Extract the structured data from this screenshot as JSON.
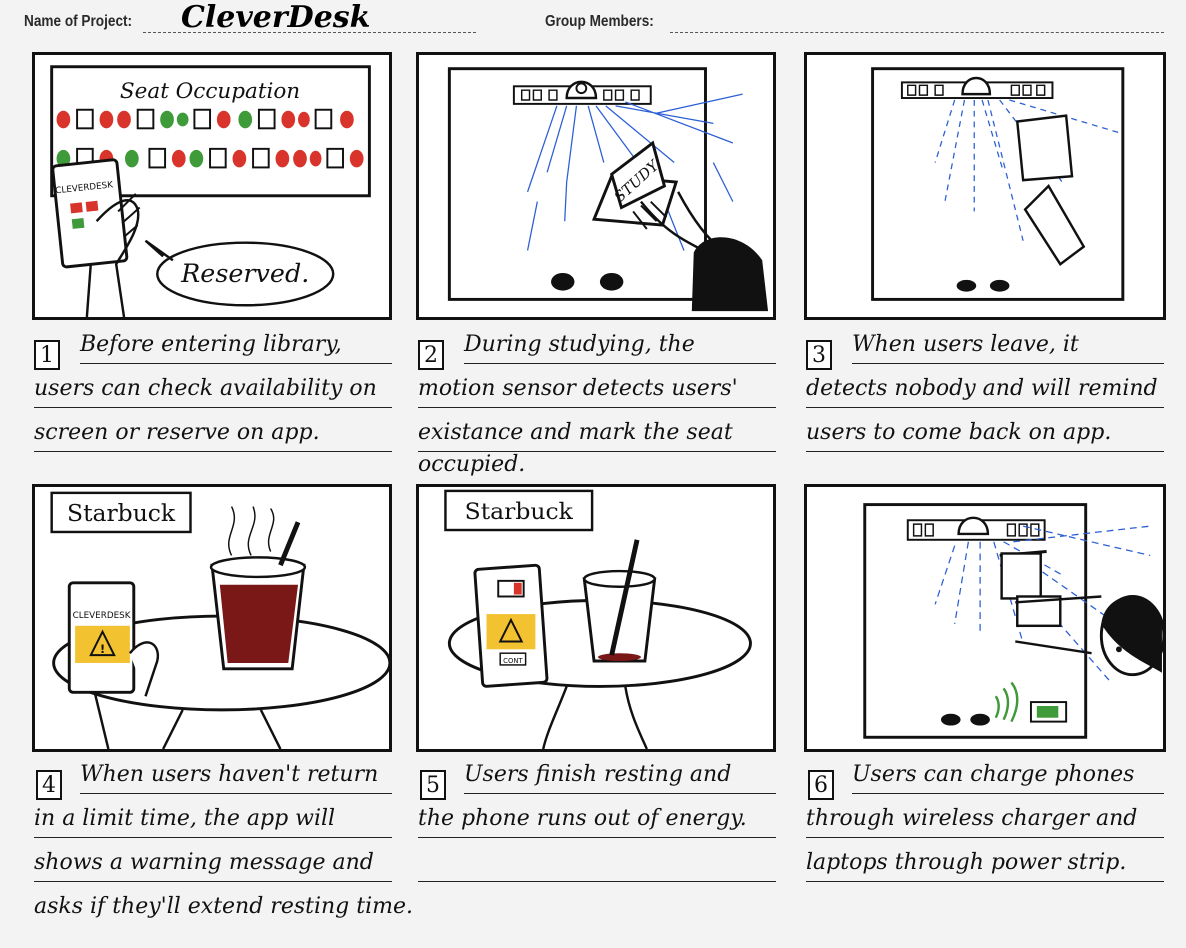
{
  "header": {
    "project_label": "Name of Project:",
    "project_value": "CleverDesk",
    "members_label": "Group Members:"
  },
  "panels": [
    {
      "number": "1",
      "screen_title": "Seat Occupation",
      "phone_brand": "CLEVERDESK",
      "bubble_text": "Reserved.",
      "caption_lines": [
        "Before entering library,",
        "users can check availability on",
        "screen or reserve on app."
      ]
    },
    {
      "number": "2",
      "book_label": "STUDY",
      "caption_lines": [
        "During studying, the",
        "motion sensor detects users'",
        "existance and mark the seat",
        "occupied."
      ]
    },
    {
      "number": "3",
      "caption_lines": [
        "When users leave, it",
        "detects nobody and will remind",
        "users to come back on app."
      ]
    },
    {
      "number": "4",
      "sign_text": "Starbuck",
      "phone_brand": "CLEVERDESK",
      "caption_lines": [
        "When users haven't return",
        "in a limit time, the app will",
        "shows a warning message and",
        "asks if they'll extend resting time."
      ]
    },
    {
      "number": "5",
      "sign_text": "Starbuck",
      "phone_button": "CONT",
      "caption_lines": [
        "Users finish resting and",
        "the phone runs out of energy.",
        ""
      ]
    },
    {
      "number": "6",
      "caption_lines": [
        "Users can charge phones",
        "through wireless charger and",
        "laptops through power strip."
      ]
    }
  ],
  "colors": {
    "occupied_red": "#d9342b",
    "free_green": "#3f9a3a",
    "warning_yellow": "#f2c230",
    "coffee": "#7a1717",
    "sensor_blue": "#2c5fd6"
  }
}
